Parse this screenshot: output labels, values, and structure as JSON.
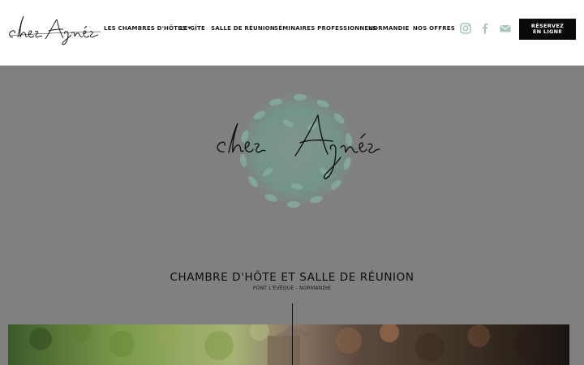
{
  "header": {
    "logo_text": "chez Agnès",
    "nav": [
      {
        "label": "LES CHAMBRES D'HÔTES",
        "dropdown": true
      },
      {
        "label": "LE GÎTE"
      },
      {
        "label": "SALLE DE RÉUNION"
      },
      {
        "label": "SÉMINAIRES PROFESSIONNELS"
      },
      {
        "label": "NORMANDIE"
      },
      {
        "label": "NOS OFFRES"
      }
    ],
    "social_icons": [
      "instagram-icon",
      "facebook-icon",
      "mail-icon"
    ],
    "cta": {
      "line1": "RÉSERVEZ",
      "line2": "EN LIGNE"
    }
  },
  "hero": {
    "logo_text": "chez Agnès",
    "title": "CHAMBRE D'HÔTE ET SALLE DE RÉUNION",
    "subtitle": "PONT L'ÉVÊQUE - NORMANDIE"
  },
  "colors": {
    "background": "#808080",
    "header": "#ffffff",
    "wreath": "#6f9a8e",
    "text": "#0d0d0d",
    "social_icon": "#a9c6bd"
  }
}
